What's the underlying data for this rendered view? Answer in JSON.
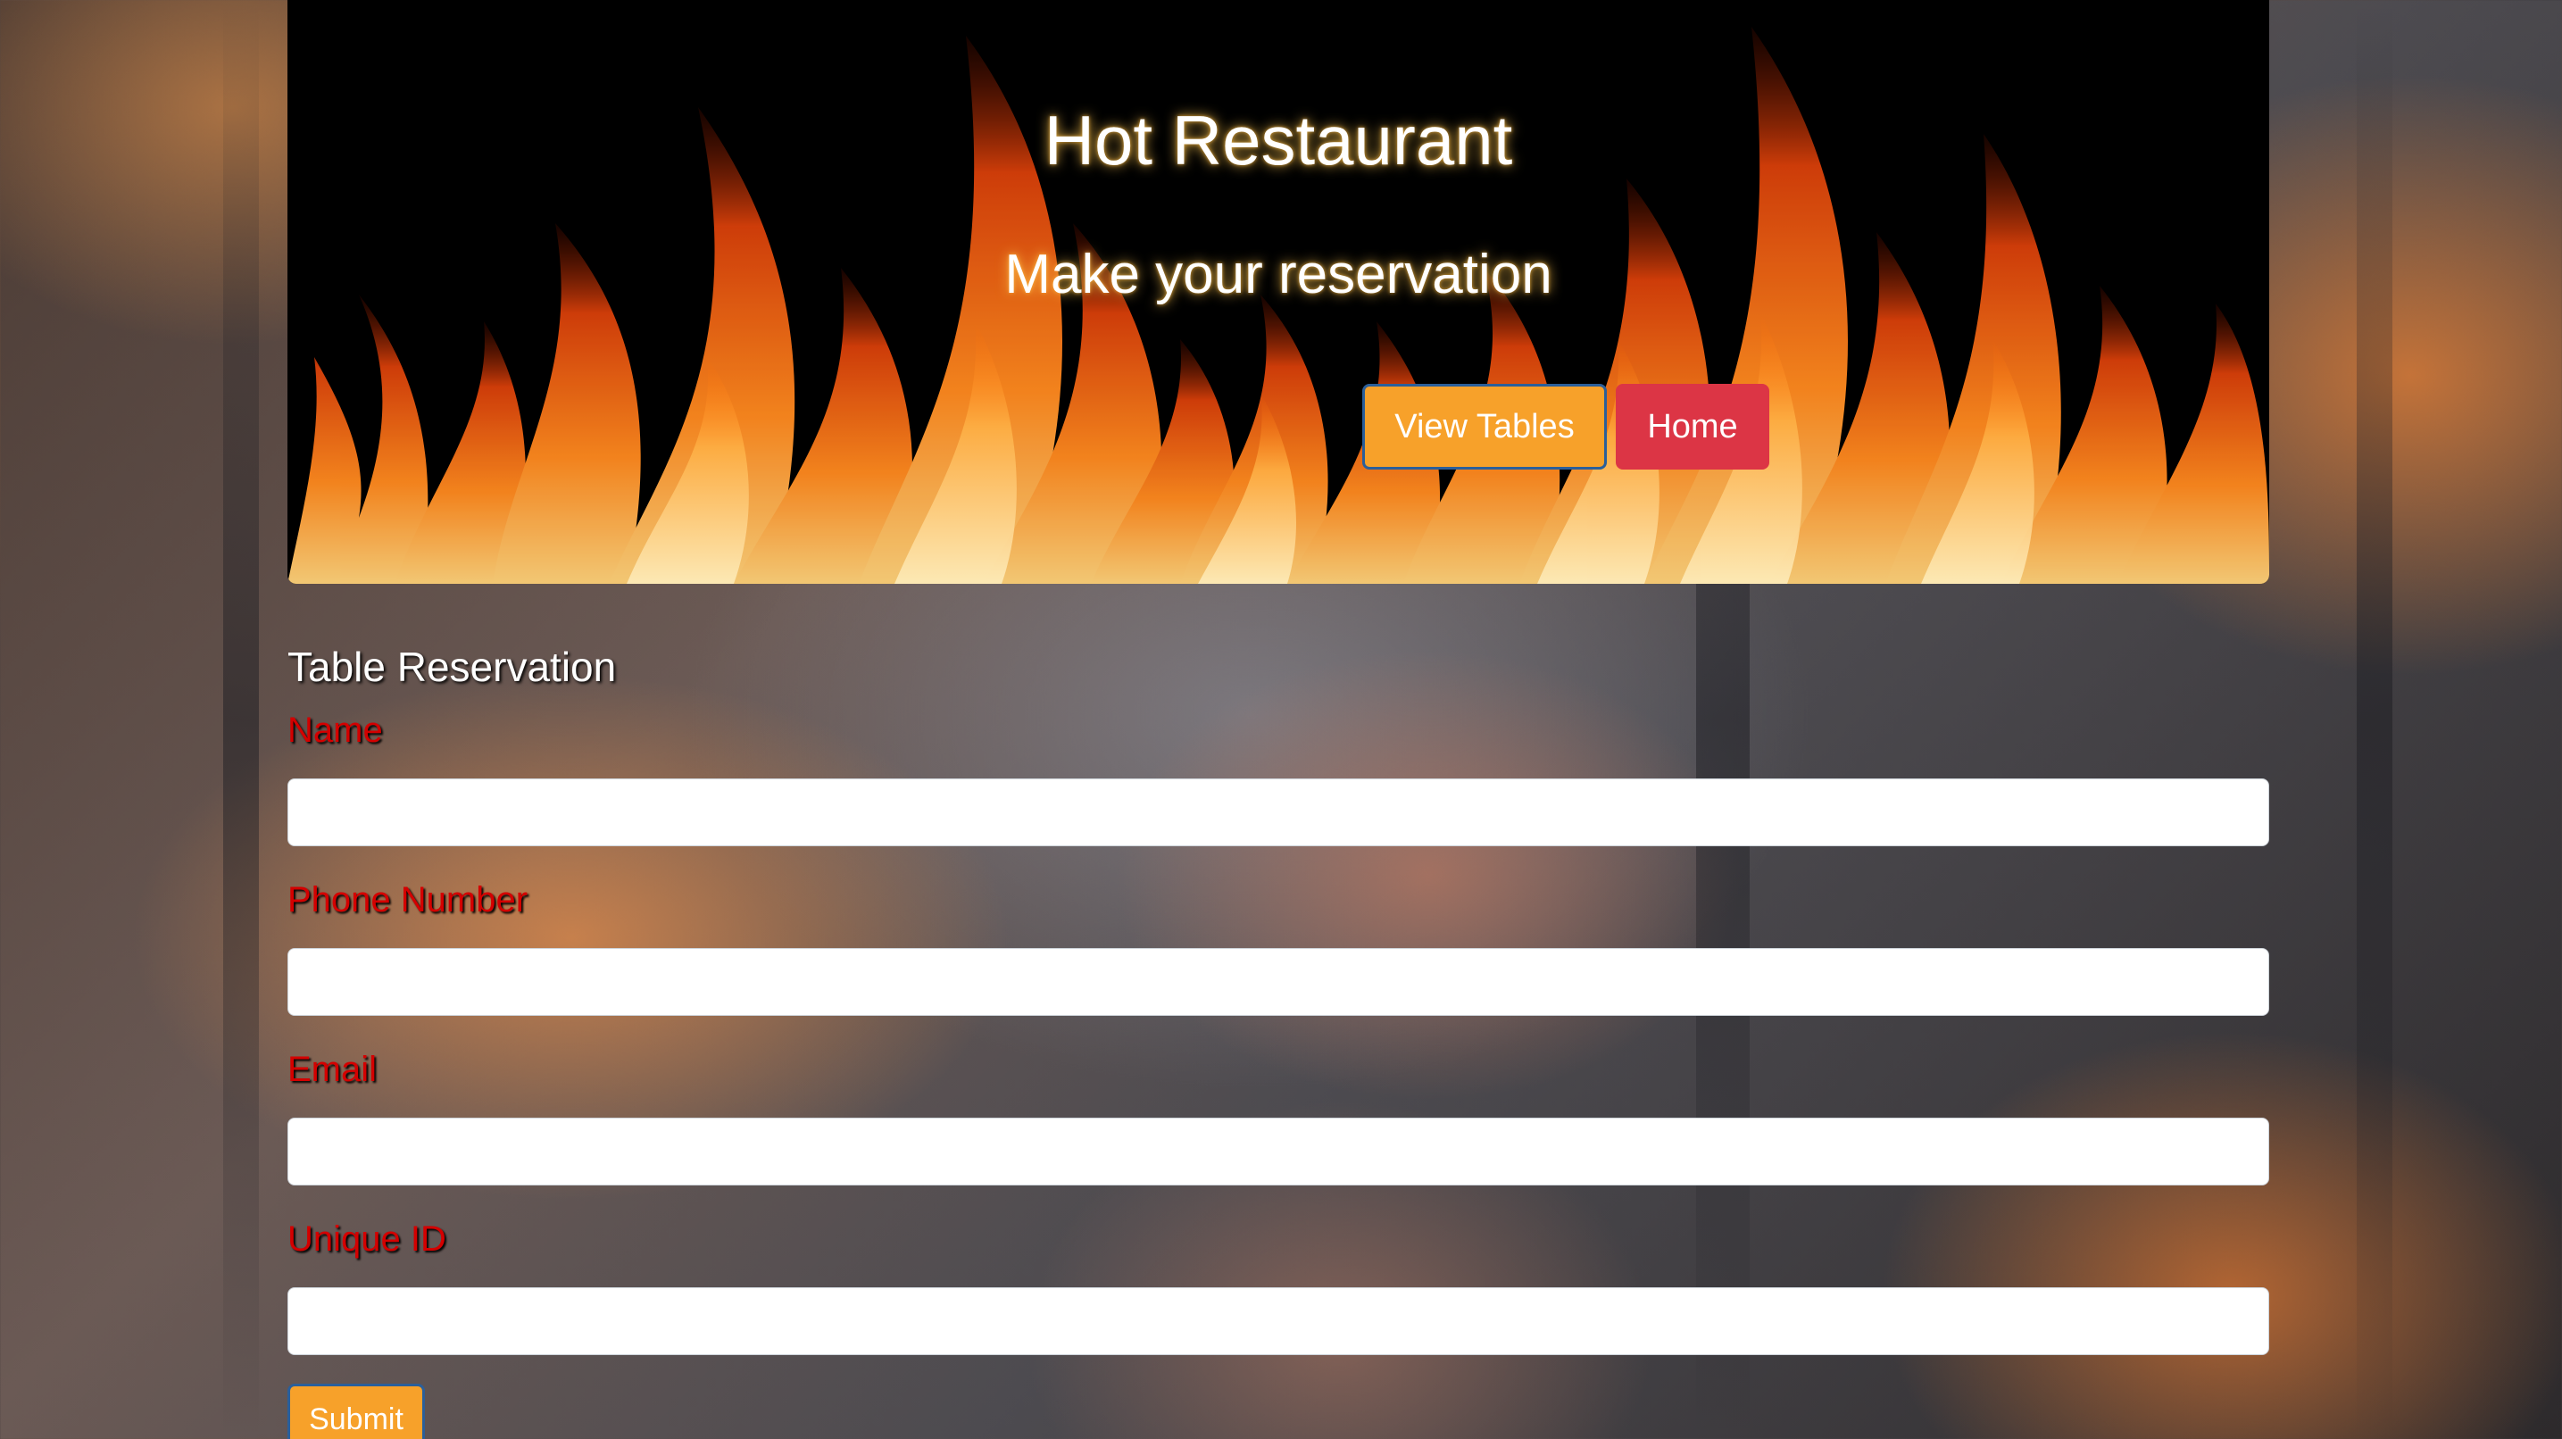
{
  "header": {
    "title": "Hot Restaurant",
    "subtitle": "Make your reservation",
    "buttons": {
      "view_tables": "View Tables",
      "home": "Home"
    }
  },
  "form": {
    "heading": "Table Reservation",
    "fields": [
      {
        "label": "Name",
        "value": "",
        "placeholder": ""
      },
      {
        "label": "Phone Number",
        "value": "",
        "placeholder": ""
      },
      {
        "label": "Email",
        "value": "",
        "placeholder": ""
      },
      {
        "label": "Unique ID",
        "value": "",
        "placeholder": ""
      }
    ],
    "submit": "Submit"
  },
  "colors": {
    "accent_orange": "#f7a12a",
    "home_red": "#dc3545",
    "label_red": "#d40000",
    "focus_border": "#2b5f9a"
  }
}
